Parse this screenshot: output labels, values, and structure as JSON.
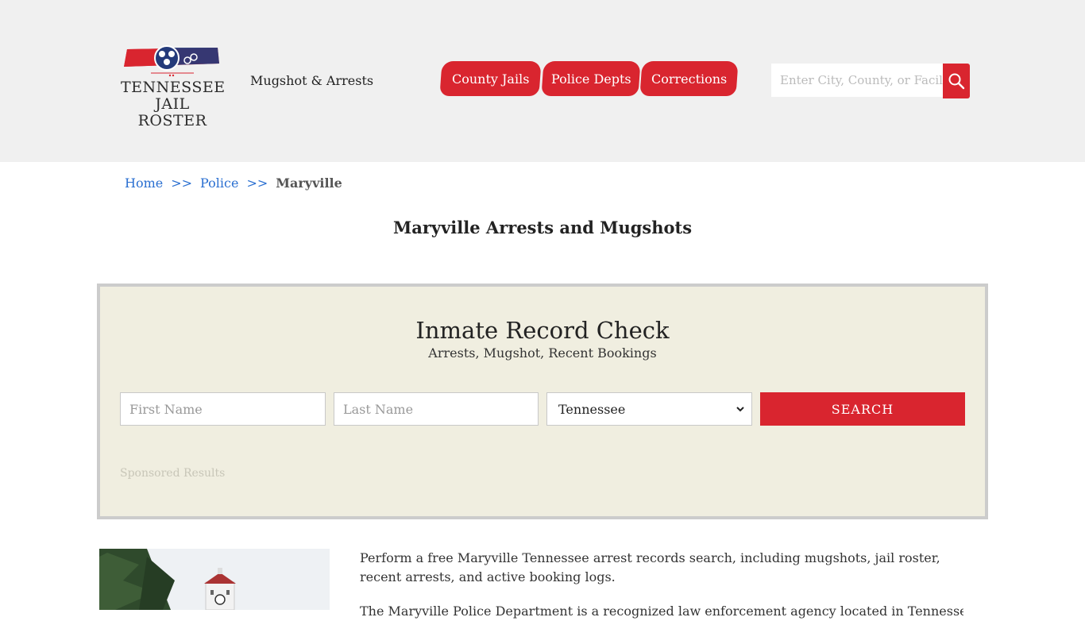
{
  "header": {
    "logo_line1": "TENNESSEE",
    "logo_line2": "JAIL ROSTER",
    "tagline": "Mugshot & Arrests",
    "nav": [
      {
        "label": "County Jails"
      },
      {
        "label": "Police Depts"
      },
      {
        "label": "Corrections"
      }
    ],
    "search_placeholder": "Enter City, County, or Facility"
  },
  "breadcrumb": {
    "home": "Home",
    "sep": ">>",
    "police": "Police",
    "current": "Maryville"
  },
  "page_title": "Maryville Arrests and Mugshots",
  "record_check": {
    "title": "Inmate Record Check",
    "subtitle": "Arrests, Mugshot, Recent Bookings",
    "first_name_placeholder": "First Name",
    "last_name_placeholder": "Last Name",
    "state_selected": "Tennessee",
    "search_label": "SEARCH",
    "sponsored": "Sponsored Results"
  },
  "content": {
    "paragraph1": "Perform a free Maryville Tennessee arrest records search, including mugshots, jail roster, recent arrests, and active booking logs.",
    "paragraph2": "The Maryville Police Department is a recognized law enforcement agency located in Tennessee. The"
  },
  "colors": {
    "brand_red": "#d9252f",
    "link_blue": "#2a6fd1",
    "header_bg": "#f0f0f0",
    "box_bg": "#f0eee0"
  }
}
